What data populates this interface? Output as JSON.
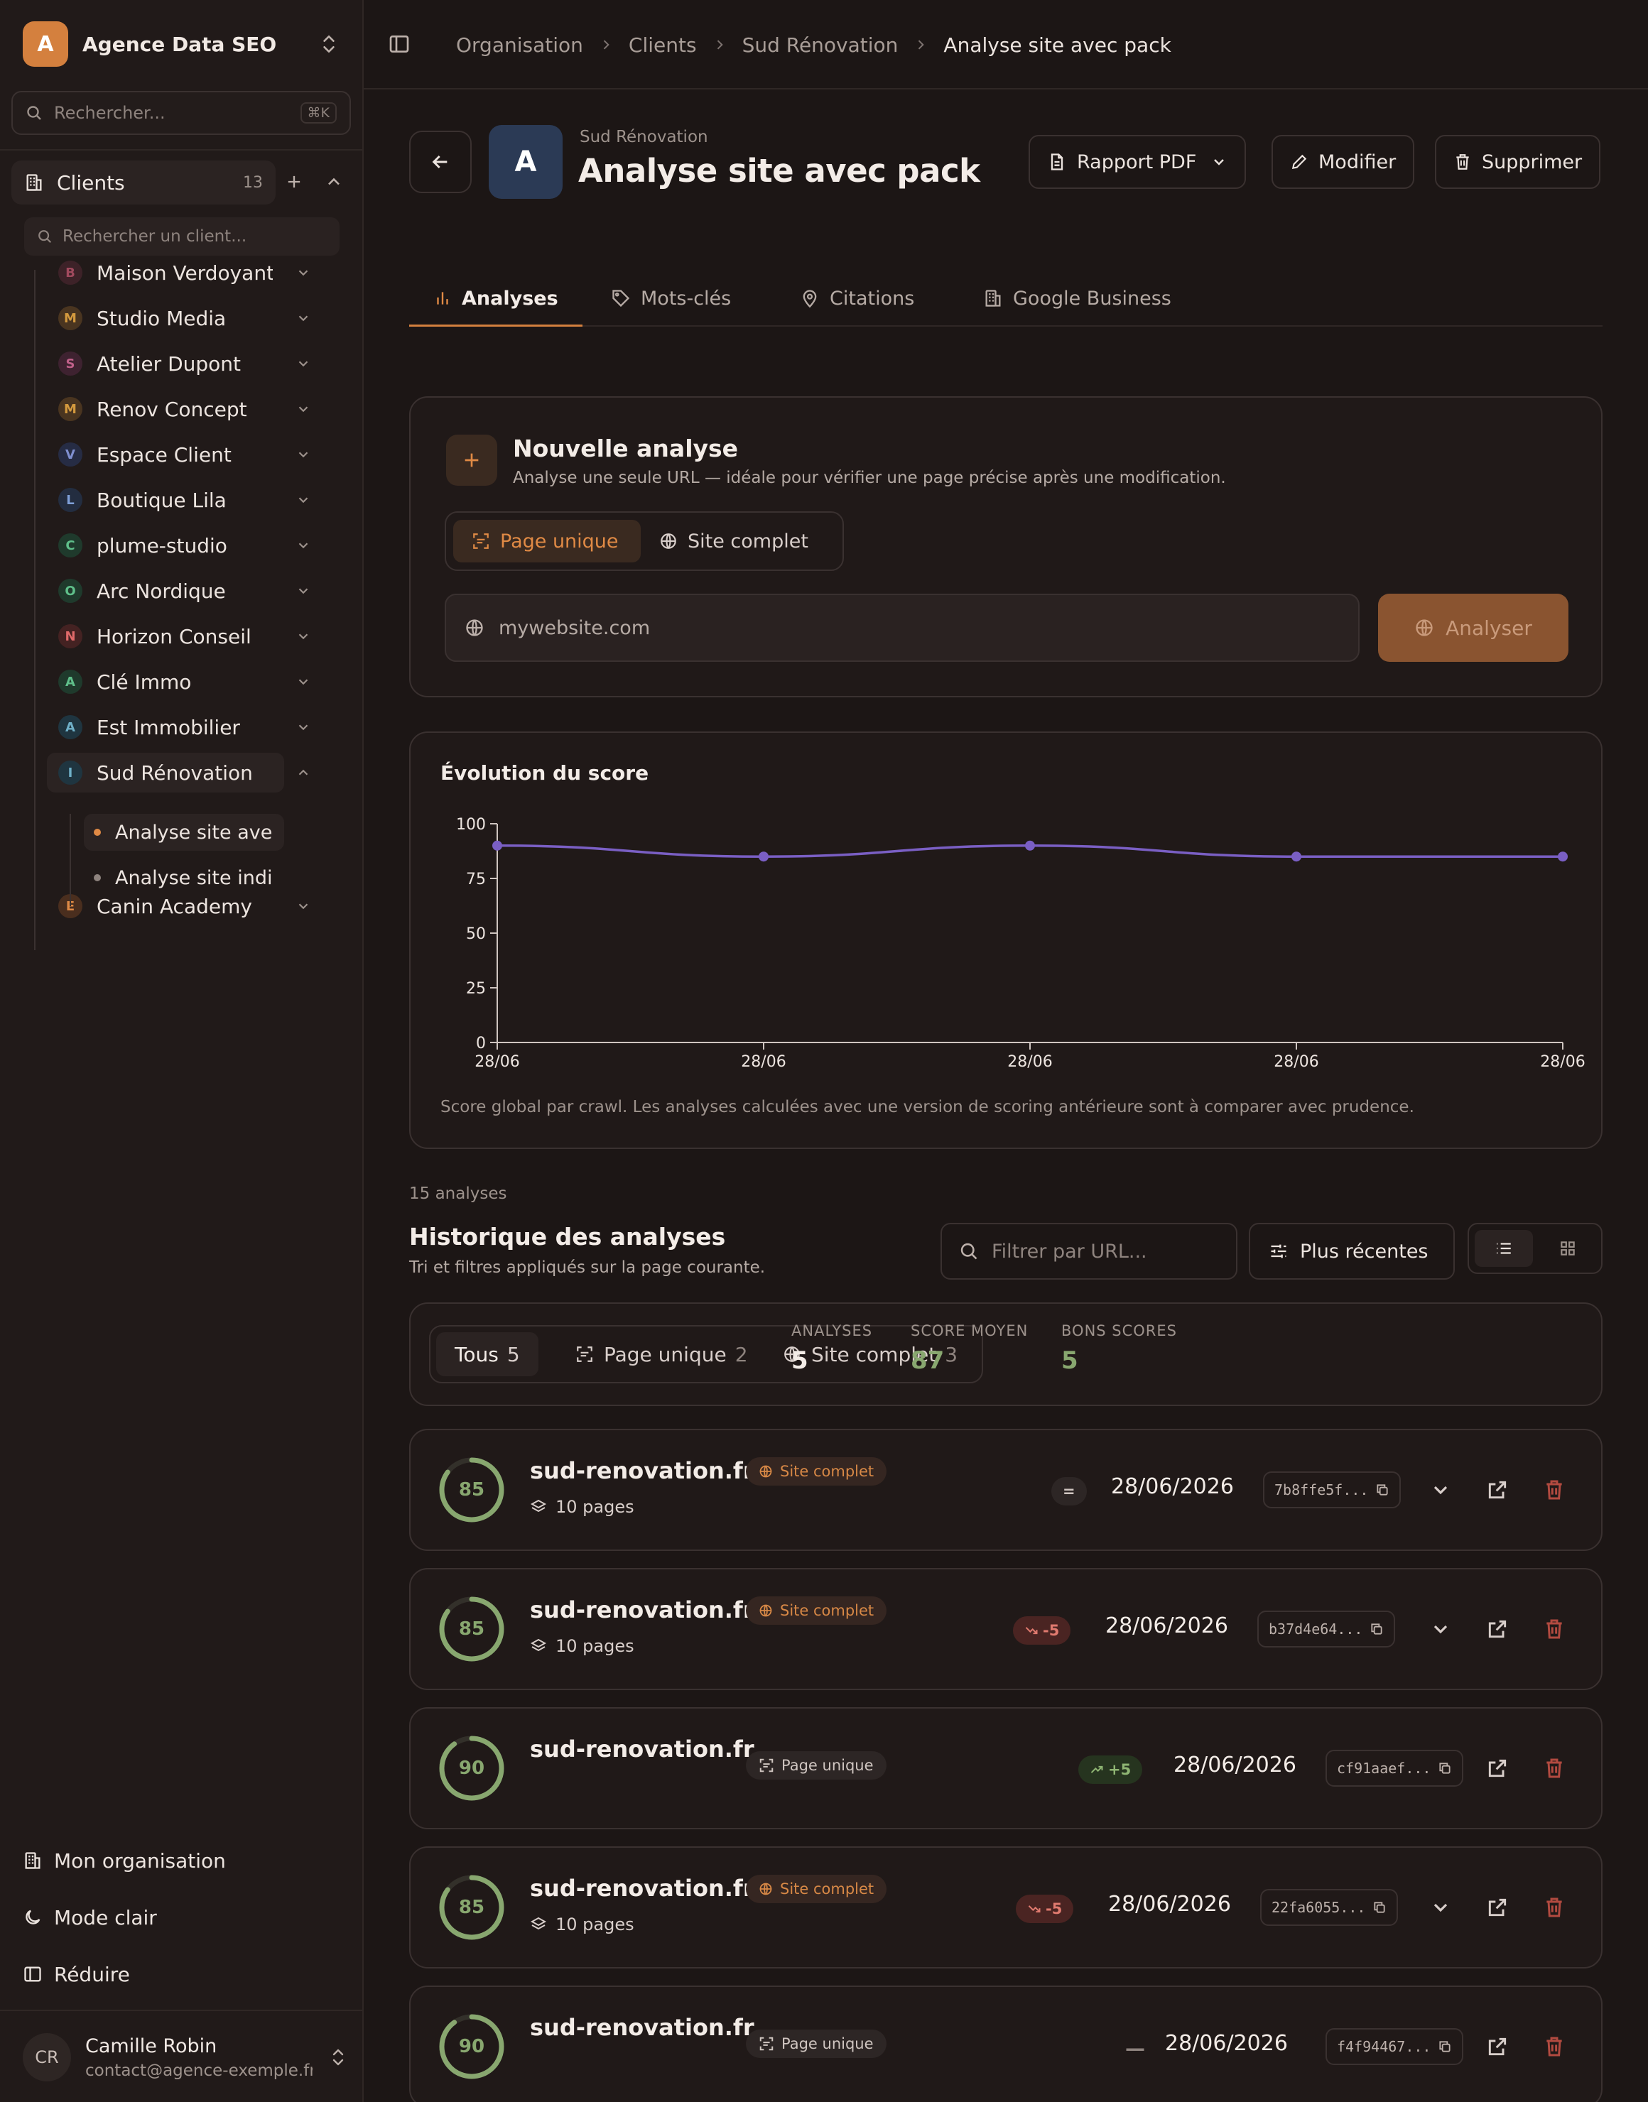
{
  "sidebar": {
    "org_initial": "A",
    "org_name": "Agence Data SEO",
    "search_placeholder": "Rechercher...",
    "search_shortcut": "⌘K",
    "clients_label": "Clients",
    "clients_count": "13",
    "client_search_placeholder": "Rechercher un client...",
    "clients": [
      {
        "initial": "B",
        "name": "Maison Verdoyante",
        "color": "#a14a5e",
        "bg": "#3d2228"
      },
      {
        "initial": "M",
        "name": "Studio Media",
        "color": "#d49a3e",
        "bg": "#4a3520"
      },
      {
        "initial": "S",
        "name": "Atelier Dupont",
        "color": "#c0608a",
        "bg": "#3e2230"
      },
      {
        "initial": "M",
        "name": "Renov Concept",
        "color": "#d49a3e",
        "bg": "#4a3520"
      },
      {
        "initial": "V",
        "name": "Espace Client",
        "color": "#7f8fd0",
        "bg": "#262c44"
      },
      {
        "initial": "L",
        "name": "Boutique Lila",
        "color": "#7fa0d8",
        "bg": "#232d40"
      },
      {
        "initial": "C",
        "name": "plume-studio",
        "color": "#5fbf8a",
        "bg": "#1f3a2c"
      },
      {
        "initial": "O",
        "name": "Arc Nordique",
        "color": "#5fbf8a",
        "bg": "#1f3a2c"
      },
      {
        "initial": "N",
        "name": "Horizon Conseil",
        "color": "#e06a6a",
        "bg": "#442222"
      },
      {
        "initial": "A",
        "name": "Clé Immo",
        "color": "#5fbf8a",
        "bg": "#1f3a2c"
      },
      {
        "initial": "A",
        "name": "Est Immobilier",
        "color": "#6fb0c8",
        "bg": "#1f3540"
      },
      {
        "initial": "I",
        "name": "Sud Rénovation",
        "color": "#6fb0c8",
        "bg": "#1f3540"
      },
      {
        "initial": "E",
        "name": "Canin Academy",
        "color": "#e08a45",
        "bg": "#4a2e1e"
      }
    ],
    "sub_items": [
      {
        "name": "Analyse site avec pack",
        "dot": "#e08a45"
      },
      {
        "name": "Analyse site individuelle",
        "dot": "#8e837e"
      }
    ],
    "bottom_nav": [
      "Mon organisation",
      "Mode clair",
      "Réduire"
    ],
    "user_initials": "CR",
    "user_name": "Camille Robin",
    "user_email": "contact@agence-exemple.fr"
  },
  "breadcrumb": [
    "Organisation",
    "Clients",
    "Sud Rénovation",
    "Analyse site avec pack"
  ],
  "header": {
    "logo_initial": "A",
    "client": "Sud Rénovation",
    "title": "Analyse site avec pack",
    "pdf_label": "Rapport PDF",
    "edit_label": "Modifier",
    "delete_label": "Supprimer"
  },
  "tabs": [
    "Analyses",
    "Mots-clés",
    "Citations",
    "Google Business"
  ],
  "new_analysis": {
    "title": "Nouvelle analyse",
    "description": "Analyse une seule URL — idéale pour vérifier une page précise après une modification.",
    "mode_single": "Page unique",
    "mode_full": "Site complet",
    "url_value": "mywebsite.com",
    "analyze_label": "Analyser"
  },
  "chart": {
    "title": "Évolution du score",
    "note": "Score global par crawl. Les analyses calculées avec une version de scoring antérieure sont à comparer avec prudence."
  },
  "chart_data": {
    "type": "line",
    "title": "Évolution du score",
    "xlabel": "",
    "ylabel": "",
    "categories": [
      "28/06",
      "28/06",
      "28/06",
      "28/06",
      "28/06"
    ],
    "series": [
      {
        "values": [
          90,
          85,
          90,
          85,
          85
        ]
      }
    ],
    "ylim": [
      0,
      100
    ],
    "yticks": [
      0,
      25,
      50,
      75,
      100
    ],
    "grid": false,
    "color": "#7a5fc4"
  },
  "history": {
    "count_label": "15 analyses",
    "title": "Historique des analyses",
    "subtitle": "Tri et filtres appliqués sur la page courante.",
    "filter_placeholder": "Filtrer par URL...",
    "sort_label": "Plus récentes",
    "filters": [
      {
        "label": "Tous",
        "count": "5"
      },
      {
        "label": "Page unique",
        "count": "2"
      },
      {
        "label": "Site complet",
        "count": "3"
      }
    ],
    "stats": [
      {
        "label": "ANALYSES",
        "value": "5",
        "color": "#f3ece7"
      },
      {
        "label": "SCORE MOYEN",
        "value": "87",
        "color": "#88a76f"
      },
      {
        "label": "BONS SCORES",
        "value": "5",
        "color": "#88a76f"
      }
    ],
    "rows": [
      {
        "score": "85",
        "score_pct": 85,
        "domain": "sud-renovation.fr",
        "type": "site",
        "type_label": "Site complet",
        "pages": "10 pages",
        "delta": "=",
        "delta_kind": "eq",
        "date": "28/06/2026",
        "hash": "7b8ffe5f...",
        "expand": true
      },
      {
        "score": "85",
        "score_pct": 85,
        "domain": "sud-renovation.fr",
        "type": "site",
        "type_label": "Site complet",
        "pages": "10 pages",
        "delta": "-5",
        "delta_kind": "neg",
        "date": "28/06/2026",
        "hash": "b37d4e64...",
        "expand": true
      },
      {
        "score": "90",
        "score_pct": 90,
        "domain": "sud-renovation.fr",
        "type": "page",
        "type_label": "Page unique",
        "pages": "",
        "delta": "+5",
        "delta_kind": "pos",
        "date": "28/06/2026",
        "hash": "cf91aaef...",
        "expand": false
      },
      {
        "score": "85",
        "score_pct": 85,
        "domain": "sud-renovation.fr",
        "type": "site",
        "type_label": "Site complet",
        "pages": "10 pages",
        "delta": "-5",
        "delta_kind": "neg",
        "date": "28/06/2026",
        "hash": "22fa6055...",
        "expand": true
      },
      {
        "score": "90",
        "score_pct": 90,
        "domain": "sud-renovation.fr",
        "type": "page",
        "type_label": "Page unique",
        "pages": "",
        "delta": "—",
        "delta_kind": "none",
        "date": "28/06/2026",
        "hash": "f4f94467...",
        "expand": false
      }
    ]
  }
}
